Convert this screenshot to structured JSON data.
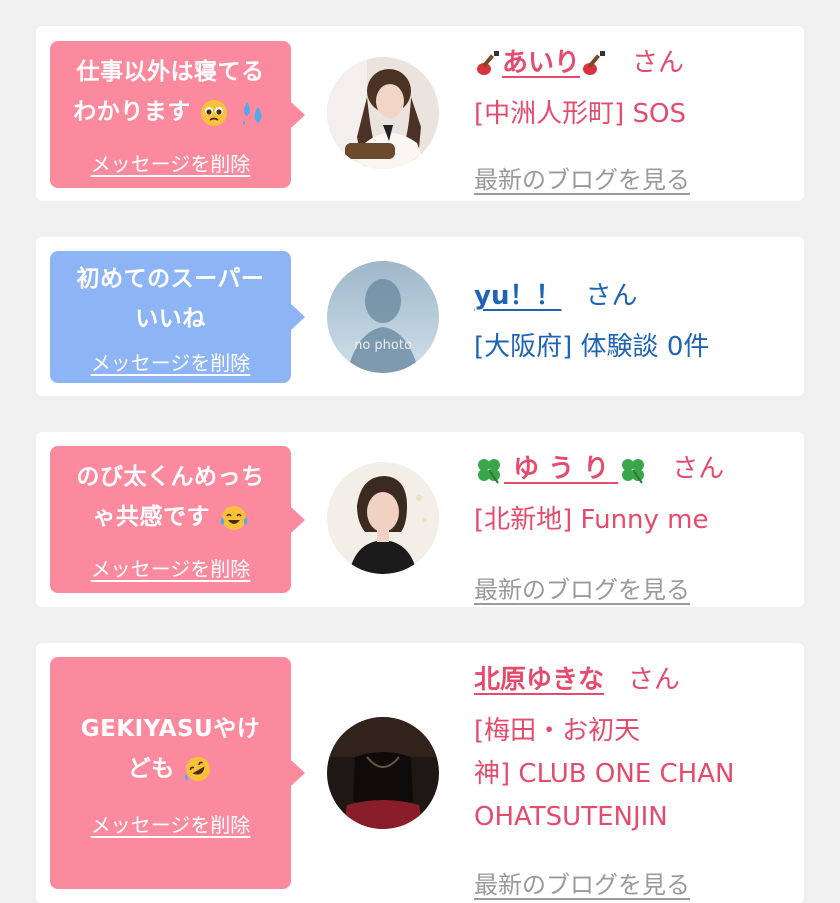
{
  "colors": {
    "bubble_pink": "#fb8a9f",
    "bubble_blue": "#8db4f5",
    "text_pink": "#e54b6c",
    "text_blue": "#1e64b4",
    "link_gray": "#9a9a9a"
  },
  "cards": [
    {
      "bubble_color": "pink",
      "message_line1": "仕事以外は寝てる",
      "message_line2": "わかります",
      "message_emojis": [
        "pleading-face",
        "sweat-droplets"
      ],
      "delete_label": "メッセージを削除",
      "name_prefix_icon": "guitar-icon",
      "name": "あいり",
      "name_suffix_icon": "guitar-icon",
      "san": "さん",
      "location": "[中洲人形町] SOS",
      "blog_link": "最新のブログを見る"
    },
    {
      "bubble_color": "blue",
      "message_line1": "初めてのスーパー",
      "message_line2": "いいね",
      "delete_label": "メッセージを削除",
      "name": "yu！！",
      "san": "さん",
      "location": "[大阪府] 体験談 0件",
      "avatar_text": "no photo"
    },
    {
      "bubble_color": "pink",
      "message_line1": "のび太くんめっち",
      "message_line2": "ゃ共感です",
      "message_emojis": [
        "tears-of-joy"
      ],
      "delete_label": "メッセージを削除",
      "name_prefix_icon": "clover-icon",
      "name": "ゆ う り",
      "name_suffix_icon": "clover-icon",
      "san": "さん",
      "location": "[北新地] Funny me",
      "blog_link": "最新のブログを見る"
    },
    {
      "bubble_color": "pink",
      "message_line1": "GEKIYASUやけ",
      "message_line2": "ども",
      "message_emojis": [
        "rolling-laughing"
      ],
      "delete_label": "メッセージを削除",
      "name": "北原ゆきな",
      "san": "さん",
      "location_line1": "[梅田・お初天",
      "location_line2": "神] CLUB ONE CHAN",
      "location_line3": "OHATSUTENJIN",
      "blog_link": "最新のブログを見る"
    }
  ]
}
